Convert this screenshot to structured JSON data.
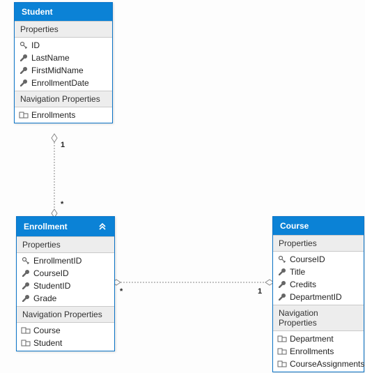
{
  "entities": {
    "student": {
      "title": "Student",
      "sections": {
        "props_label": "Properties",
        "props": [
          {
            "name": "ID",
            "icon": "key"
          },
          {
            "name": "LastName",
            "icon": "wrench"
          },
          {
            "name": "FirstMidName",
            "icon": "wrench"
          },
          {
            "name": "EnrollmentDate",
            "icon": "wrench"
          }
        ],
        "nav_label": "Navigation Properties",
        "nav": [
          {
            "name": "Enrollments",
            "icon": "nav"
          }
        ]
      }
    },
    "enrollment": {
      "title": "Enrollment",
      "has_chevrons": true,
      "sections": {
        "props_label": "Properties",
        "props": [
          {
            "name": "EnrollmentID",
            "icon": "key"
          },
          {
            "name": "CourseID",
            "icon": "wrench"
          },
          {
            "name": "StudentID",
            "icon": "wrench"
          },
          {
            "name": "Grade",
            "icon": "wrench"
          }
        ],
        "nav_label": "Navigation Properties",
        "nav": [
          {
            "name": "Course",
            "icon": "nav"
          },
          {
            "name": "Student",
            "icon": "nav"
          }
        ]
      }
    },
    "course": {
      "title": "Course",
      "sections": {
        "props_label": "Properties",
        "props": [
          {
            "name": "CourseID",
            "icon": "key"
          },
          {
            "name": "Title",
            "icon": "wrench"
          },
          {
            "name": "Credits",
            "icon": "wrench"
          },
          {
            "name": "DepartmentID",
            "icon": "wrench"
          }
        ],
        "nav_label": "Navigation Properties",
        "nav": [
          {
            "name": "Department",
            "icon": "nav"
          },
          {
            "name": "Enrollments",
            "icon": "nav"
          },
          {
            "name": "CourseAssignments",
            "icon": "nav"
          }
        ]
      }
    }
  },
  "relations": {
    "student_enrollment": {
      "end1": "1",
      "end2": "*"
    },
    "enrollment_course": {
      "end1": "*",
      "end2": "1"
    }
  }
}
